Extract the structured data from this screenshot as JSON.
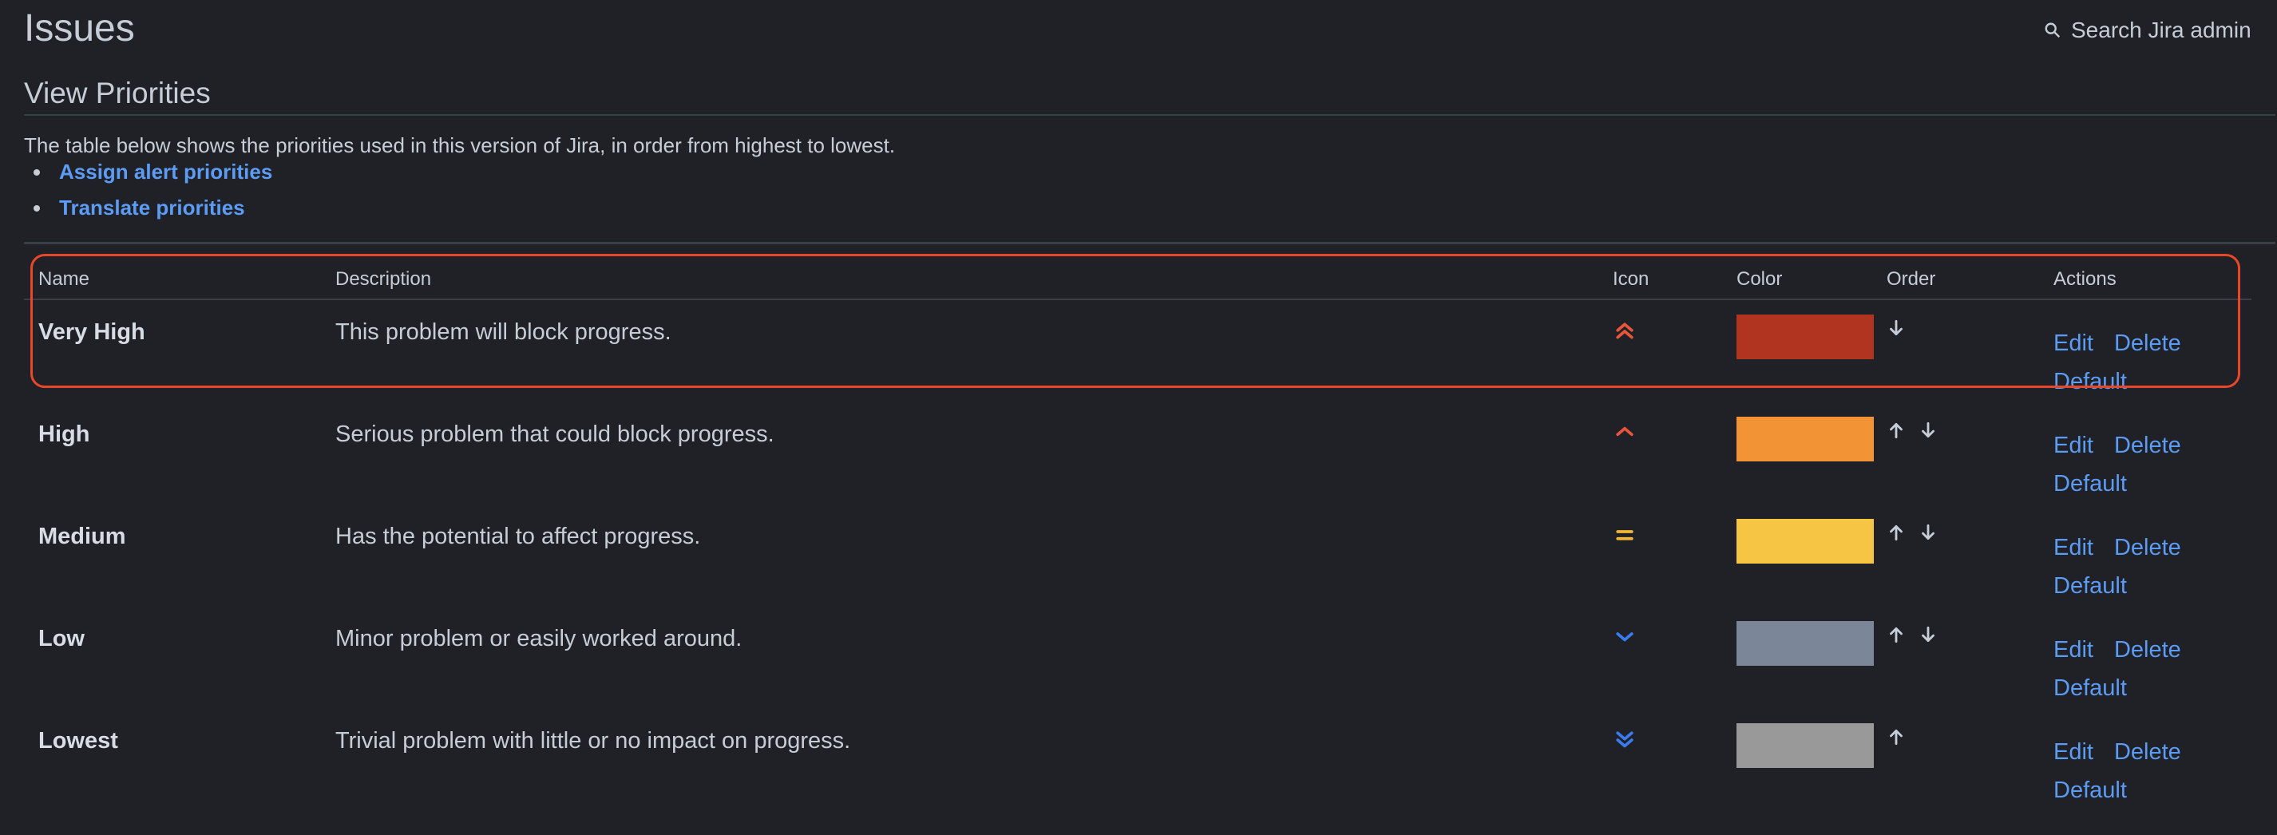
{
  "header": {
    "title": "Issues",
    "search_label": "Search Jira admin"
  },
  "section": {
    "title": "View Priorities",
    "intro": "The table below shows the priorities used in this version of Jira, in order from highest to lowest.",
    "links": [
      "Assign alert priorities",
      "Translate priorities"
    ]
  },
  "table": {
    "columns": [
      "Name",
      "Description",
      "Icon",
      "Color",
      "Order",
      "Actions"
    ],
    "action_labels": {
      "edit": "Edit",
      "delete": "Delete",
      "default": "Default"
    },
    "rows": [
      {
        "name": "Very High",
        "description": "This problem will block progress.",
        "icon": "double-chevron-up-icon",
        "icon_color": "#e8553a",
        "color": "#b0341f",
        "order": [
          "down"
        ]
      },
      {
        "name": "High",
        "description": "Serious problem that could block progress.",
        "icon": "chevron-up-icon",
        "icon_color": "#e8553a",
        "color": "#f29435",
        "order": [
          "up",
          "down"
        ]
      },
      {
        "name": "Medium",
        "description": "Has the potential to affect progress.",
        "icon": "equals-icon",
        "icon_color": "#f2b833",
        "color": "#f6c543",
        "order": [
          "up",
          "down"
        ]
      },
      {
        "name": "Low",
        "description": "Minor problem or easily worked around.",
        "icon": "chevron-down-icon",
        "icon_color": "#3a7cf0",
        "color": "#7b8699",
        "order": [
          "up",
          "down"
        ]
      },
      {
        "name": "Lowest",
        "description": "Trivial problem with little or no impact on progress.",
        "icon": "double-chevron-down-icon",
        "icon_color": "#3a7cf0",
        "color": "#999999",
        "order": [
          "up"
        ]
      }
    ]
  }
}
